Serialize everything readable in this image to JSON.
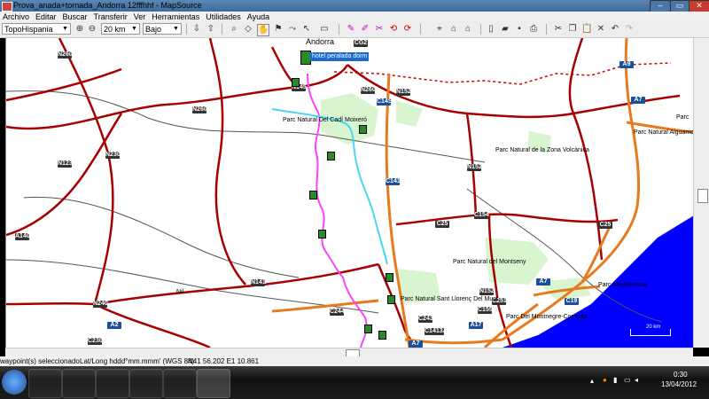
{
  "window": {
    "title": "Prova_anada+tornada_Andorra 12fffhhf - MapSource",
    "btn_min": "–",
    "btn_max": "▭",
    "btn_close": "✕"
  },
  "menu": [
    "Archivo",
    "Editar",
    "Buscar",
    "Transferir",
    "Ver",
    "Herramientas",
    "Utilidades",
    "Ayuda"
  ],
  "toolbar": {
    "map_product": "TopoHispania",
    "zoom_level": "20 km",
    "detail_level": "Bajo"
  },
  "map": {
    "colors": {
      "primary_road": "#a80000",
      "secondary_road": "#e87a1e",
      "track_magenta": "#ff40ff",
      "track_cyan": "#4ad8f0",
      "sea": "#0000ff",
      "park": "#d8f5d0",
      "rail": "#555555",
      "border": "#d00000"
    },
    "road_shields": [
      "N260",
      "CG2",
      "N145",
      "N260",
      "N152",
      "C14S",
      "N260",
      "N123",
      "N230",
      "C1411",
      "N152",
      "C154",
      "C25",
      "A140",
      "N141",
      "C244",
      "N240",
      "A2",
      "C230",
      "N152",
      "C251",
      "C155",
      "C243",
      "C1413A",
      "A17",
      "A7",
      "C19",
      "A9",
      "A7",
      "C25",
      "A7"
    ],
    "place_labels": [
      "Andorra",
      "Parc Natural Del Cadí Moixeró",
      "Parc Natural de la Zona Volcànica",
      "Parc Natural Aiguamolls",
      "Parc",
      "Parc Natural del Montseny",
      "Parc Natural Sant Llorenç Del Munt",
      "Parc Del Montnegre-Corredor",
      "Parc Mediterrània",
      "Nil"
    ],
    "waypoint_label": "hotel peralada dorm",
    "scale_label": "20 km"
  },
  "status": {
    "selection": "waypoint(s) seleccionado",
    "format": "Lat/Long hddd°mm.mmm' (WGS 84)",
    "coords": "N41 56.202 E1 10.861"
  },
  "taskbar": {
    "time": "0:30",
    "date": "13/04/2012"
  }
}
